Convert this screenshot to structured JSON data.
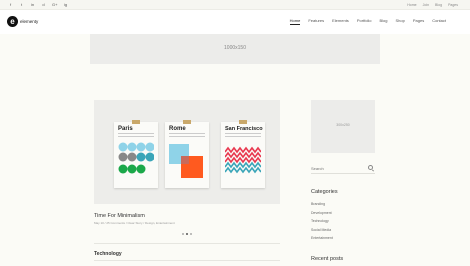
{
  "topbar": {
    "social_icons": [
      "f",
      "t",
      "in",
      "d",
      "G+",
      "ig"
    ],
    "links": [
      "Home",
      "Join",
      "Blog",
      "Pages"
    ]
  },
  "header": {
    "logo_text": "elementy",
    "logo_letter": "e",
    "nav": [
      "Home",
      "Features",
      "Elements",
      "Portfolio",
      "Blog",
      "Shop",
      "Pages",
      "Contact"
    ]
  },
  "banner": {
    "label": "1000x150"
  },
  "post": {
    "posters": [
      {
        "city": "Paris",
        "accent": "#3aa5b8"
      },
      {
        "city": "Rome",
        "accent": "#ff5a1f"
      },
      {
        "city": "San Francisco",
        "accent": "#e8384f"
      }
    ],
    "title": "Time For Minimalism",
    "meta": "May 10 / 25 Comments / Clear Story / Design, Entertainment",
    "slide_count": 3,
    "active_slide": 1
  },
  "section": {
    "title": "Technology"
  },
  "sidebar": {
    "image_label": "300x250",
    "search_placeholder": "Search",
    "categories_title": "Categories",
    "categories": [
      "Branding",
      "Development",
      "Technology",
      "Social Media",
      "Entertainment"
    ],
    "recent_title": "Recent posts"
  }
}
